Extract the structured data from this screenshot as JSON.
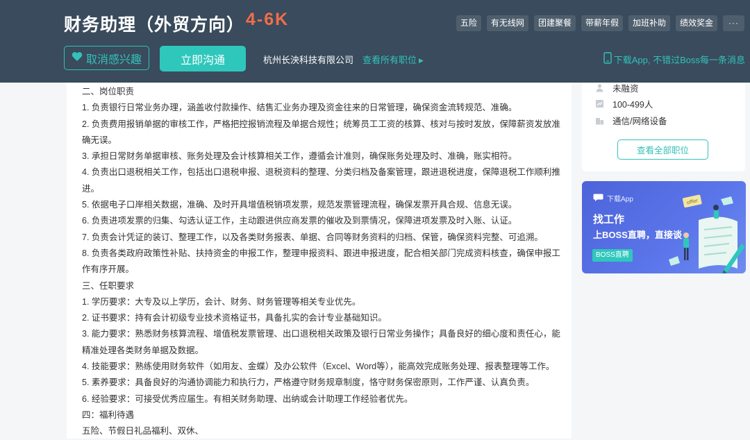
{
  "header": {
    "title": "财务助理（外贸方向）",
    "salary": "4-6K",
    "tags": [
      "五险",
      "有无线网",
      "团建聚餐",
      "带薪年假",
      "加班补助",
      "绩效奖金",
      "···"
    ],
    "uninterest_label": "取消感兴趣",
    "chat_label": "立即沟通",
    "company": "杭州长泱科技有限公司",
    "all_jobs_link": "查看所有职位",
    "download_tip": "下载App, 不错过Boss每一条消息"
  },
  "description": [
    "二、岗位职责",
    "1. 负责银行日常业务办理，涵盖收付款操作、结售汇业务办理及资金往来的日常管理，确保资金流转规范、准确。",
    "2. 负责费用报销单据的审核工作，严格把控报销流程及单据合规性；统筹员工工资的核算、核对与按时发放，保障薪资发放准确无误。",
    "3. 承担日常财务单据审核、账务处理及会计核算相关工作，遵循会计准则，确保账务处理及时、准确，账实相符。",
    "4. 负责出口退税相关工作，包括出口退税申报、退税资料的整理、分类归档及备案管理，跟进退税进度，保障退税工作顺利推进。",
    "5. 依据电子口岸相关数据，准确、及时开具增值税销项发票，规范发票管理流程，确保发票开具合规、信息无误。",
    "6. 负责进项发票的归集、勾选认证工作，主动跟进供应商发票的催收及到票情况，保障进项发票及时入账、认证。",
    "7. 负责会计凭证的装订、整理工作，以及各类财务报表、单据、合同等财务资料的归档、保管，确保资料完整、可追溯。",
    "8. 负责各类政府政策性补贴、扶持资金的申报工作，整理申报资料、跟进申报进度，配合相关部门完成资料核查，确保申报工作有序开展。",
    "三、任职要求",
    "1. 学历要求：大专及以上学历，会计、财务、财务管理等相关专业优先。",
    "2. 证书要求：持有会计初级专业技术资格证书，具备扎实的会计专业基础知识。",
    "3. 能力要求：熟悉财务核算流程、增值税发票管理、出口退税相关政策及银行日常业务操作；具备良好的细心度和责任心，能精准处理各类财务单据及数据。",
    "4. 技能要求：熟练使用财务软件（如用友、金蝶）及办公软件（Excel、Word等），能高效完成账务处理、报表整理等工作。",
    "5. 素养要求：具备良好的沟通协调能力和执行力，严格遵守财务规章制度，恪守财务保密原则，工作严谨、认真负责。",
    "6. 经验要求：可接受优秀应届生。有相关财务助理、出纳或会计助理工作经验者优先。",
    "四：福利待遇",
    "五险、节假日礼品福利、双休、"
  ],
  "company_info": {
    "stage": "未融资",
    "size": "100-499人",
    "industry": "通信/网络设备",
    "view_all_label": "查看全部职位"
  },
  "ad": {
    "top_label": "下载App",
    "headline": "找工作",
    "subline": "上BOSS直聘，直接谈",
    "badge": "BOSS直聘",
    "offer": "offer"
  },
  "colors": {
    "header_bg": "#394b5c",
    "accent": "#2fc7bc",
    "salary": "#f26d4a"
  }
}
